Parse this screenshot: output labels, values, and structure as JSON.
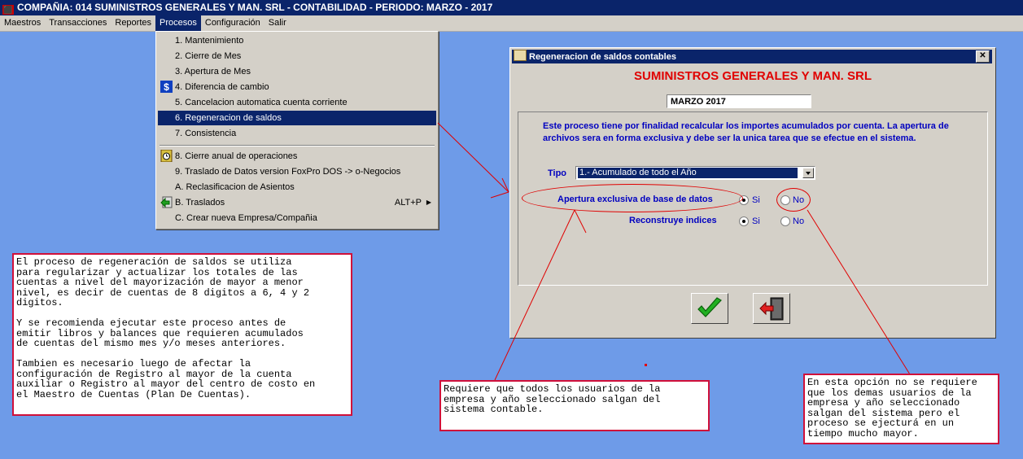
{
  "window": {
    "title": "COMPAÑIA: 014 SUMINISTROS GENERALES Y MAN. SRL  -  CONTABILIDAD  -  PERIODO: MARZO - 2017"
  },
  "menubar": {
    "items": [
      "Maestros",
      "Transacciones",
      "Reportes",
      "Procesos",
      "Configuración",
      "Salir"
    ],
    "active": "Procesos"
  },
  "procesos_menu": {
    "items": [
      {
        "label": "1. Mantenimiento"
      },
      {
        "label": "2. Cierre de Mes"
      },
      {
        "label": "3. Apertura de Mes"
      },
      {
        "label": "4. Diferencia de cambio",
        "icon": "dollar-icon"
      },
      {
        "label": "5. Cancelacion automatica cuenta corriente"
      },
      {
        "label": "6. Regeneracion de saldos",
        "selected": true
      },
      {
        "label": "7. Consistencia"
      },
      {
        "label": "8. Cierre anual de operaciones",
        "icon": "clock-icon"
      },
      {
        "label": "9. Traslado de Datos version FoxPro DOS  -> o-Negocios"
      },
      {
        "label": "A. Reclasificacion de Asientos"
      },
      {
        "label": "B. Traslados",
        "icon": "transfer-icon",
        "accelerator": "ALT+P",
        "submenu": true
      },
      {
        "label": "C. Crear nueva Empresa/Compañia"
      }
    ]
  },
  "dialog": {
    "title": "Regeneracion de saldos contables",
    "company": "SUMINISTROS GENERALES Y MAN. SRL",
    "period": "MARZO 2017",
    "description": "Este proceso tiene por finalidad recalcular los importes acumulados por cuenta. La apertura de archivos sera en forma exclusiva y debe ser la unica tarea que se efectue en el sistema.",
    "tipo_label": "Tipo",
    "tipo_value": "1.- Acumulado de todo el Año",
    "apertura_label": "Apertura exclusiva de base de datos",
    "apertura_value": "Si",
    "reconstruye_label": "Reconstruye indices",
    "reconstruye_value": "Si",
    "opt_si": "Si",
    "opt_no": "No",
    "accent": "#E00000",
    "label_color": "#0000C0"
  },
  "notes": {
    "left": "El proceso de regeneración de saldos se utiliza\npara regularizar y actualizar los totales de las\ncuentas a nivel del mayorización de mayor a menor\nnivel, es decir de cuentas de 8 digitos a 6, 4 y 2\ndigitos.\n\nY se recomienda ejecutar este proceso antes de\nemitir libros y balances que requieren acumulados\nde cuentas del mismo mes y/o meses anteriores.\n\nTambien es necesario luego de afectar la\nconfiguración de Registro al mayor de la cuenta\nauxiliar o Registro al mayor del centro de costo en\nel Maestro de Cuentas (Plan De Cuentas).",
    "middle": "Requiere que todos los usuarios de la\nempresa y año seleccionado salgan del\nsistema contable.",
    "right": "En esta opción no se requiere\nque los demas usuarios de la\nempresa y año seleccionado\nsalgan del sistema pero el\nproceso se ejecturá en un\ntiempo mucho mayor."
  }
}
